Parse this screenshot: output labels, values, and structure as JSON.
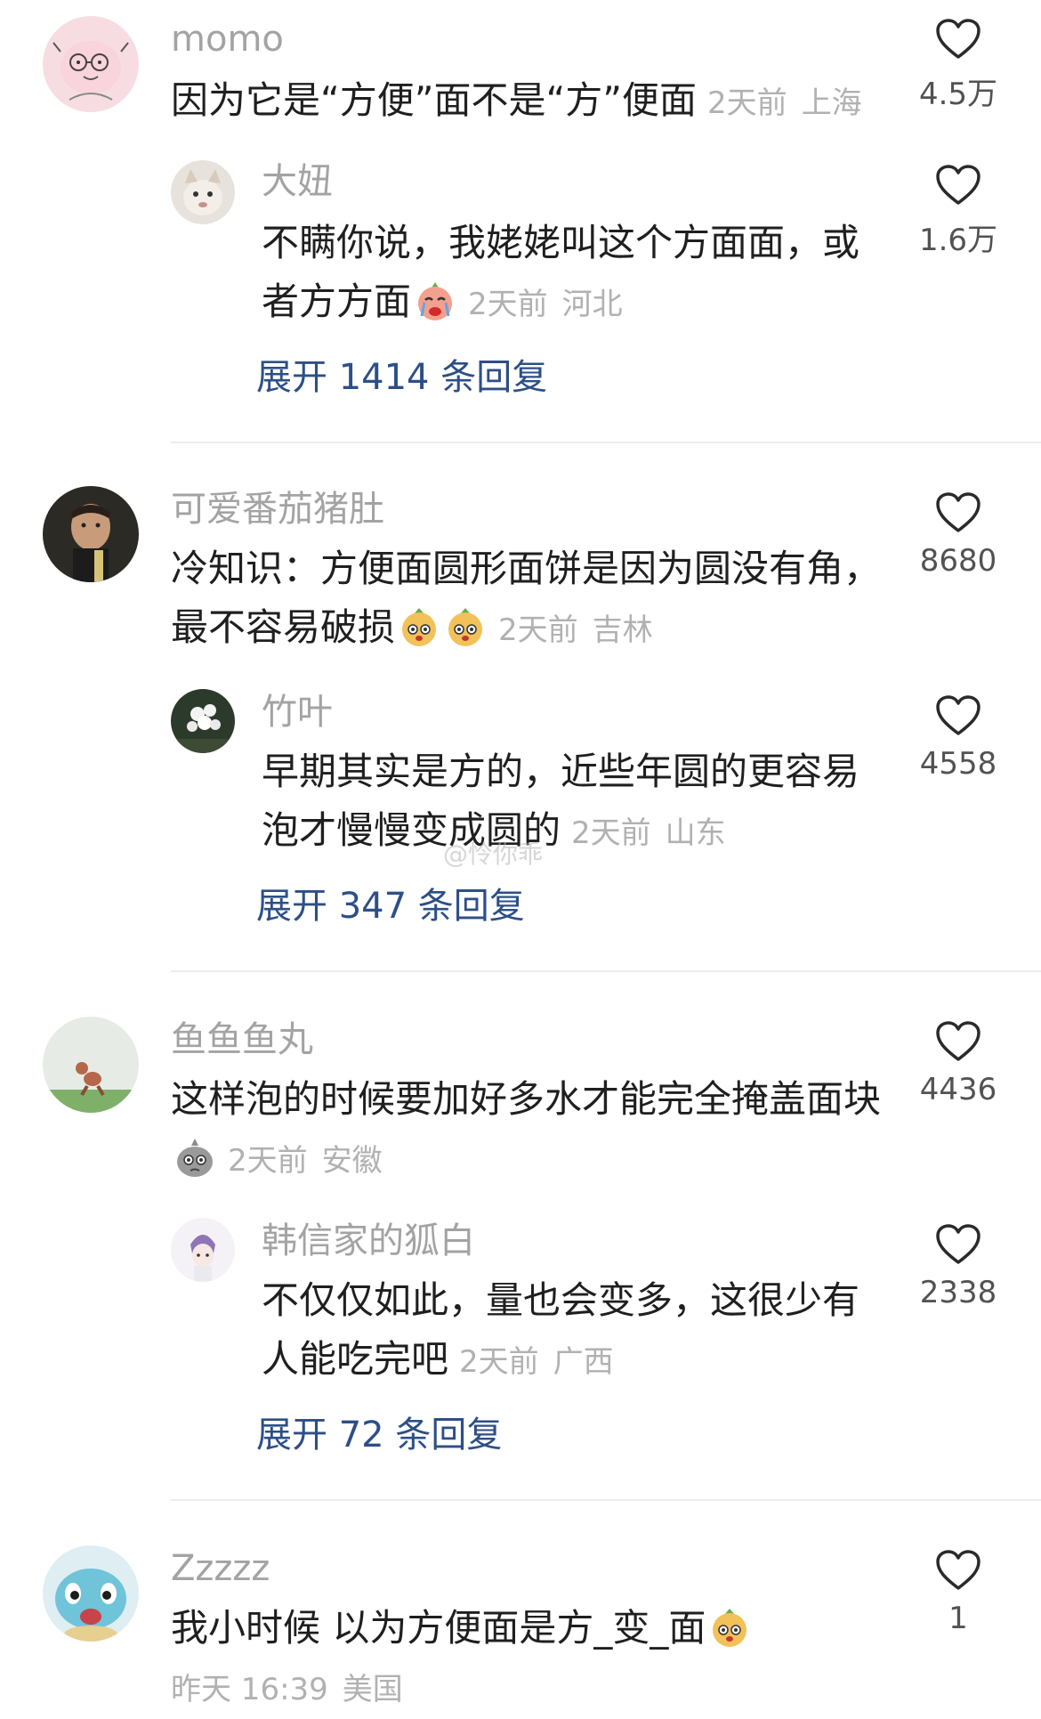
{
  "threads": [
    {
      "comment": {
        "name": "momo",
        "text": "因为它是“方便”面不是“方”便面",
        "time": "2天前",
        "location": "上海",
        "likes": "4.5万"
      },
      "reply": {
        "name": "大妞",
        "text": "不瞒你说，我姥姥叫这个方面面，或者方方面",
        "time": "2天前",
        "location": "河北",
        "likes": "1.6万"
      },
      "expand_label": "展开 1414 条回复"
    },
    {
      "comment": {
        "name": "可爱番茄猪肚",
        "text": "冷知识：方便面圆形面饼是因为圆没有角，最不容易破损",
        "time": "2天前",
        "location": "吉林",
        "likes": "8680"
      },
      "reply": {
        "name": "竹叶",
        "text": "早期其实是方的，近些年圆的更容易泡才慢慢变成圆的",
        "time": "2天前",
        "location": "山东",
        "likes": "4558"
      },
      "expand_label": "展开 347 条回复"
    },
    {
      "comment": {
        "name": "鱼鱼鱼丸",
        "text": "这样泡的时候要加好多水才能完全掩盖面块",
        "time": "2天前",
        "location": "安徽",
        "likes": "4436"
      },
      "reply": {
        "name": "韩信家的狐白",
        "text": "不仅仅如此，量也会变多，这很少有人能吃完吧",
        "time": "2天前",
        "location": "广西",
        "likes": "2338"
      },
      "expand_label": "展开 72 条回复"
    },
    {
      "comment": {
        "name": "Zzzzz",
        "text": "我小时候 以为方便面是方_变_面",
        "time": "昨天 16:39",
        "location": "美国",
        "likes": "1"
      }
    }
  ],
  "watermark": "@怜你乖",
  "icons": {
    "like": "heart-outline-icon",
    "emoji_cry": "crying-emoji-icon",
    "emoji_peach": "peach-face-emoji-icon",
    "emoji_gray": "gray-blob-emoji-icon"
  },
  "colors": {
    "link": "#2d4f86",
    "meta": "#b1b1b1",
    "name": "#a3a3a3"
  }
}
